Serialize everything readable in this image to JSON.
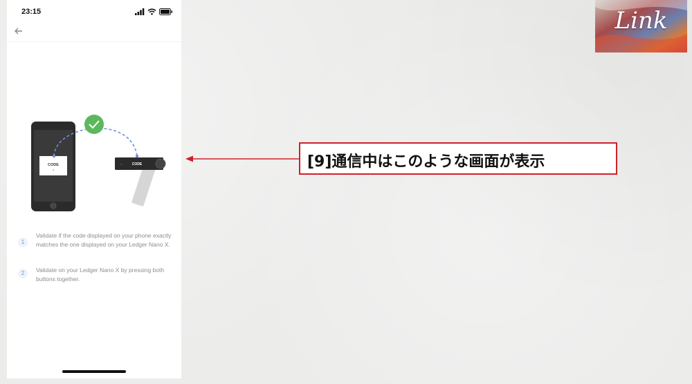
{
  "status_bar": {
    "time": "23:15"
  },
  "illustration": {
    "phone_code_label": "CODE",
    "device_code_label": "CODE"
  },
  "steps": [
    {
      "number": "1",
      "text": "Validate if the code displayed on your phone exactly matches the one displayed on your Ledger Nano X."
    },
    {
      "number": "2",
      "text": "Validate on your Ledger Nano X by pressing both buttons together."
    }
  ],
  "annotation": {
    "text": "[9]通信中はこのような画面が表示"
  },
  "logo": {
    "text": "Link"
  },
  "colors": {
    "annotation_border": "#cf2027",
    "check_green": "#5cb85c",
    "dashed_line": "#6e8fd6",
    "step_badge": "#eef2fb"
  }
}
